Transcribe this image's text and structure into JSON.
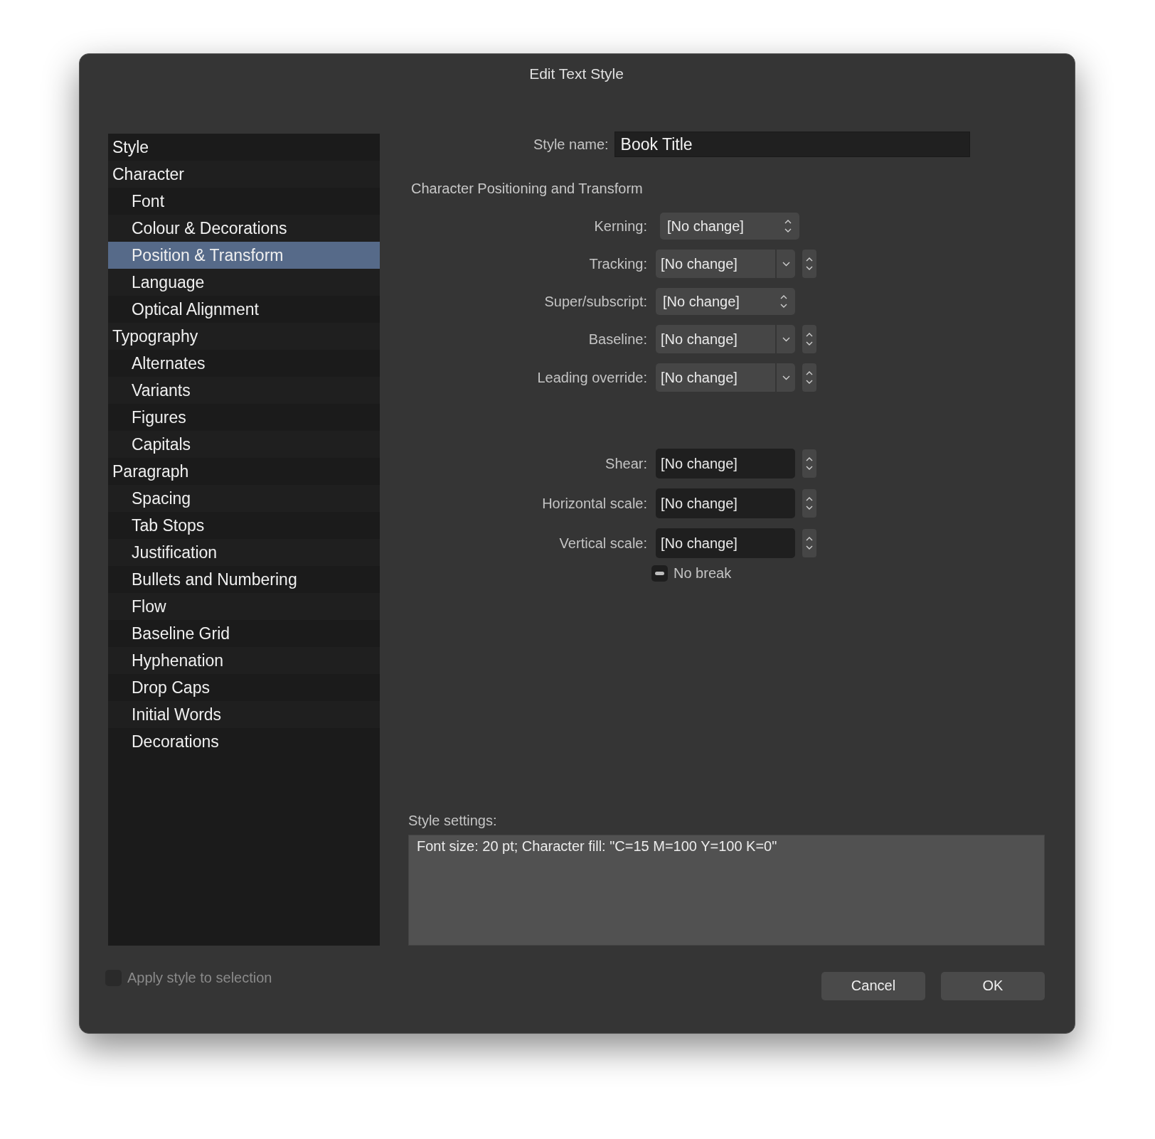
{
  "window": {
    "title": "Edit Text Style"
  },
  "sidebar": {
    "items": [
      {
        "label": "Style",
        "selected": false
      },
      {
        "label": "Character",
        "selected": false,
        "children": [
          {
            "label": "Font",
            "selected": false
          },
          {
            "label": "Colour & Decorations",
            "selected": false
          },
          {
            "label": "Position & Transform",
            "selected": true
          },
          {
            "label": "Language",
            "selected": false
          },
          {
            "label": "Optical Alignment",
            "selected": false
          }
        ]
      },
      {
        "label": "Typography",
        "selected": false,
        "children": [
          {
            "label": "Alternates",
            "selected": false
          },
          {
            "label": "Variants",
            "selected": false
          },
          {
            "label": "Figures",
            "selected": false
          },
          {
            "label": "Capitals",
            "selected": false
          }
        ]
      },
      {
        "label": "Paragraph",
        "selected": false,
        "children": [
          {
            "label": "Spacing",
            "selected": false
          },
          {
            "label": "Tab Stops",
            "selected": false
          },
          {
            "label": "Justification",
            "selected": false
          },
          {
            "label": "Bullets and Numbering",
            "selected": false
          },
          {
            "label": "Flow",
            "selected": false
          },
          {
            "label": "Baseline Grid",
            "selected": false
          },
          {
            "label": "Hyphenation",
            "selected": false
          },
          {
            "label": "Drop Caps",
            "selected": false
          },
          {
            "label": "Initial Words",
            "selected": false
          },
          {
            "label": "Decorations",
            "selected": false
          }
        ]
      }
    ]
  },
  "style_name": {
    "label": "Style name:",
    "value": "Book Title"
  },
  "section_title": "Character Positioning and Transform",
  "fields": [
    {
      "kind": "popup",
      "label": "Kerning:",
      "value": "[No change]"
    },
    {
      "kind": "combo",
      "label": "Tracking:",
      "value": "[No change]"
    },
    {
      "kind": "popup",
      "label": "Super/subscript:",
      "value": "[No change]"
    },
    {
      "kind": "combo",
      "label": "Baseline:",
      "value": "[No change]"
    },
    {
      "kind": "combo",
      "label": "Leading override:",
      "value": "[No change]"
    },
    {
      "kind": "spacer"
    },
    {
      "kind": "spin",
      "label": "Shear:",
      "value": "[No change]"
    },
    {
      "kind": "spin",
      "label": "Horizontal scale:",
      "value": "[No change]"
    },
    {
      "kind": "spin",
      "label": "Vertical scale:",
      "value": "[No change]"
    }
  ],
  "no_break": {
    "label": "No break",
    "mixed": true
  },
  "style_settings": {
    "label": "Style settings:",
    "text": "Font size: 20 pt; Character fill: \"C=15 M=100 Y=100 K=0\""
  },
  "apply_to_selection": {
    "label": "Apply style to selection",
    "checked": false,
    "disabled": true
  },
  "buttons": [
    "Cancel",
    "OK"
  ]
}
